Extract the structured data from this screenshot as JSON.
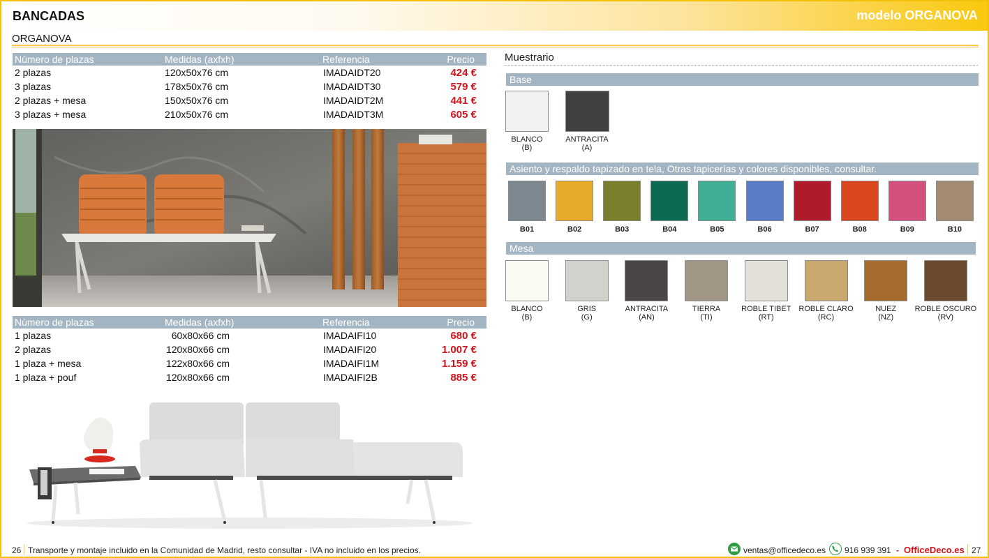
{
  "header": {
    "title": "BANCADAS",
    "model": "modelo ORGANOVA"
  },
  "subtitle": "ORGANOVA",
  "table1": {
    "headers": [
      "Número de plazas",
      "Medidas (axfxh)",
      "Referencia",
      "Precio"
    ],
    "rows": [
      {
        "plazas": "2 plazas",
        "medidas": "120x50x76 cm",
        "ref": "IMADAIDT20",
        "precio": "424 €"
      },
      {
        "plazas": "3 plazas",
        "medidas": "178x50x76 cm",
        "ref": "IMADAIDT30",
        "precio": "579 €"
      },
      {
        "plazas": "2 plazas + mesa",
        "medidas": "150x50x76 cm",
        "ref": "IMADAIDT2M",
        "precio": "441 €"
      },
      {
        "plazas": "3 plazas + mesa",
        "medidas": "210x50x76 cm",
        "ref": "IMADAIDT3M",
        "precio": "605 €"
      }
    ]
  },
  "table2": {
    "headers": [
      "Número de plazas",
      "Medidas (axfxh)",
      "Referencia",
      "Precio"
    ],
    "rows": [
      {
        "plazas": "1 plazas",
        "medidas": "60x80x66 cm",
        "ref": "IMADAIFI10",
        "precio": "680 €"
      },
      {
        "plazas": "2 plazas",
        "medidas": "120x80x66 cm",
        "ref": "IMADAIFI20",
        "precio": "1.007 €"
      },
      {
        "plazas": "1 plaza + mesa",
        "medidas": "122x80x66 cm",
        "ref": "IMADAIFI1M",
        "precio": "1.159 €"
      },
      {
        "plazas": "1 plaza + pouf",
        "medidas": "120x80x66 cm",
        "ref": "IMADAIFI2B",
        "precio": "885 €"
      }
    ]
  },
  "muestrario": {
    "title": "Muestrario",
    "base": {
      "label": "Base",
      "items": [
        {
          "name": "BLANCO",
          "code": "(B)",
          "color": "#f2f1f1"
        },
        {
          "name": "ANTRACITA",
          "code": "(A)",
          "color": "#423f40"
        }
      ]
    },
    "tapizado": {
      "label": "Asiento y respaldo tapizado en tela, Otras tapicerías y colores disponibles, consultar.",
      "items": [
        {
          "code": "B01",
          "color": "#7e8890"
        },
        {
          "code": "B02",
          "color": "#e6a92a"
        },
        {
          "code": "B03",
          "color": "#7b7f2c"
        },
        {
          "code": "B04",
          "color": "#0d6a52"
        },
        {
          "code": "B05",
          "color": "#3fae95"
        },
        {
          "code": "B06",
          "color": "#5a7bc5"
        },
        {
          "code": "B07",
          "color": "#b01b2c"
        },
        {
          "code": "B08",
          "color": "#d9461f"
        },
        {
          "code": "B09",
          "color": "#d2517f"
        },
        {
          "code": "B10",
          "color": "#a38c72"
        }
      ]
    },
    "mesa": {
      "label": "Mesa",
      "items": [
        {
          "name": "BLANCO",
          "code": "(B)",
          "color": "#fbfaf3"
        },
        {
          "name": "GRIS",
          "code": "(G)",
          "color": "#d3d1cc"
        },
        {
          "name": "ANTRACITA",
          "code": "(AN)",
          "color": "#4a4648"
        },
        {
          "name": "TIERRA",
          "code": "(TI)",
          "color": "#a19585"
        },
        {
          "name": "ROBLE TIBET",
          "code": "(RT)",
          "color": "#e3dfd9"
        },
        {
          "name": "ROBLE CLARO",
          "code": "(RC)",
          "color": "#c9a870"
        },
        {
          "name": "NUEZ",
          "code": "(NZ)",
          "color": "#a46d2e"
        },
        {
          "name": "ROBLE OSCURO",
          "code": "(RV)",
          "color": "#6c4a30"
        }
      ]
    }
  },
  "footer": {
    "page_left": "26",
    "note": "Transporte y montaje incluido en la Comunidad de Madrid, resto consultar - IVA no incluido en los precios.",
    "email": "ventas@officedeco.es",
    "phone": "916 939 391",
    "dash": "-",
    "brand": "OfficeDeco.es",
    "page_right": "27"
  },
  "colors": {
    "accent": "#f4c10a",
    "price_red": "#d3121b",
    "table_header": "#a3b4c2"
  }
}
